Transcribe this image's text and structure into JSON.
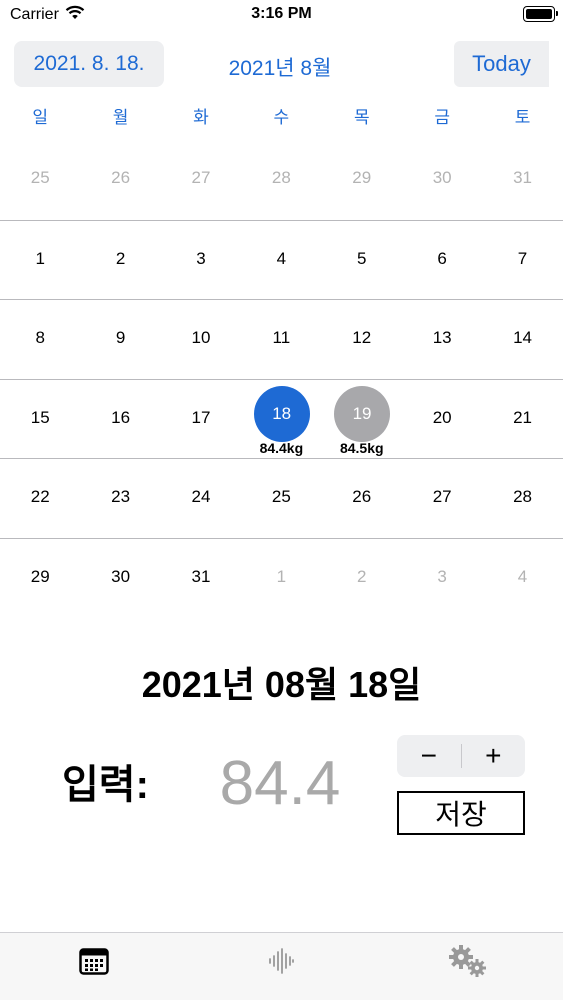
{
  "status_bar": {
    "carrier": "Carrier",
    "time": "3:16 PM"
  },
  "header": {
    "selected_date_button": "2021. 8. 18.",
    "month_title": "2021년 8월",
    "today_button": "Today"
  },
  "weekdays": [
    "일",
    "월",
    "화",
    "수",
    "목",
    "금",
    "토"
  ],
  "weeks": [
    [
      {
        "day": "25",
        "muted": true
      },
      {
        "day": "26",
        "muted": true
      },
      {
        "day": "27",
        "muted": true
      },
      {
        "day": "28",
        "muted": true
      },
      {
        "day": "29",
        "muted": true
      },
      {
        "day": "30",
        "muted": true
      },
      {
        "day": "31",
        "muted": true
      }
    ],
    [
      {
        "day": "1"
      },
      {
        "day": "2"
      },
      {
        "day": "3"
      },
      {
        "day": "4"
      },
      {
        "day": "5"
      },
      {
        "day": "6"
      },
      {
        "day": "7"
      }
    ],
    [
      {
        "day": "8"
      },
      {
        "day": "9"
      },
      {
        "day": "10"
      },
      {
        "day": "11"
      },
      {
        "day": "12"
      },
      {
        "day": "13"
      },
      {
        "day": "14"
      }
    ],
    [
      {
        "day": "15"
      },
      {
        "day": "16"
      },
      {
        "day": "17"
      },
      {
        "day": "18",
        "state": "selected",
        "weight": "84.4kg"
      },
      {
        "day": "19",
        "state": "marked",
        "weight": "84.5kg"
      },
      {
        "day": "20"
      },
      {
        "day": "21"
      }
    ],
    [
      {
        "day": "22"
      },
      {
        "day": "23"
      },
      {
        "day": "24"
      },
      {
        "day": "25"
      },
      {
        "day": "26"
      },
      {
        "day": "27"
      },
      {
        "day": "28"
      }
    ],
    [
      {
        "day": "29"
      },
      {
        "day": "30"
      },
      {
        "day": "31"
      },
      {
        "day": "1",
        "muted": true
      },
      {
        "day": "2",
        "muted": true
      },
      {
        "day": "3",
        "muted": true
      },
      {
        "day": "4",
        "muted": true
      }
    ]
  ],
  "entry": {
    "selected_date_title": "2021년 08월 18일",
    "input_label": "입력:",
    "weight_value": "84.4",
    "minus_label": "−",
    "plus_label": "+",
    "save_label": "저장"
  },
  "tab_bar": {
    "tabs": [
      {
        "icon": "calendar-icon",
        "active": true
      },
      {
        "icon": "waveform-icon",
        "active": false
      },
      {
        "icon": "gears-icon",
        "active": false
      }
    ]
  },
  "colors": {
    "accent": "#1e6ad4",
    "marked": "#a8a8ab",
    "muted_text": "#b3b3b3",
    "button_bg": "#eeeff1"
  }
}
